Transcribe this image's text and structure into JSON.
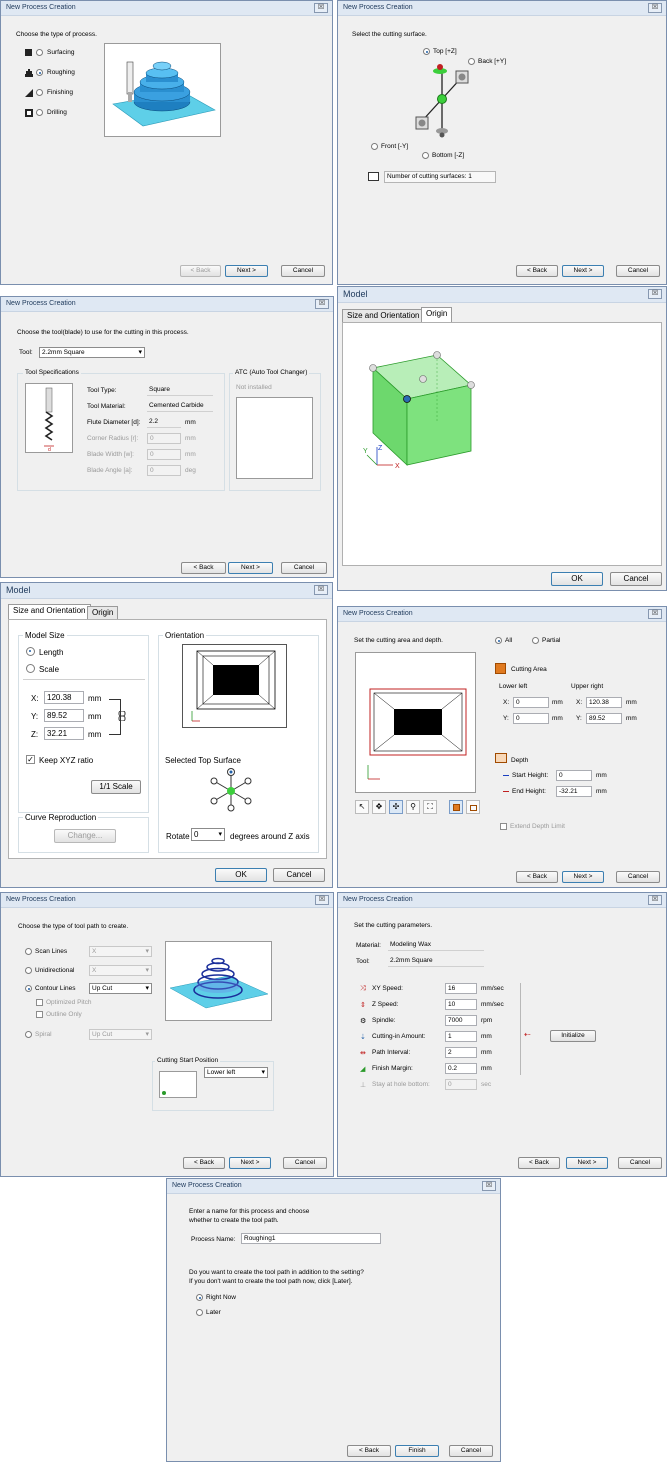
{
  "common": {
    "title": "New Process Creation",
    "close": "☒",
    "back": "< Back",
    "next": "Next >",
    "cancel": "Cancel",
    "finish": "Finish",
    "ok": "OK",
    "model_title": "Model"
  },
  "process_type": {
    "prompt": "Choose the type of process.",
    "options": [
      "Surfacing",
      "Roughing",
      "Finishing",
      "Drilling"
    ],
    "selected": "Roughing"
  },
  "cutting_surface": {
    "prompt": "Select the cutting surface.",
    "top": "Top [+Z]",
    "back": "Back [+Y]",
    "front": "Front [-Y]",
    "bottom": "Bottom [-Z]",
    "count_label": "Number of cutting surfaces: 1"
  },
  "tool": {
    "prompt": "Choose the tool(blade) to use for the cutting in this process.",
    "tool_label": "Tool:",
    "tool_value": "2.2mm Square",
    "specs_heading": "Tool Specifications",
    "atc_heading": "ATC (Auto Tool Changer)",
    "atc_status": "Not installed",
    "rows": [
      {
        "label": "Tool Type:",
        "value": "Square",
        "unit": ""
      },
      {
        "label": "Tool Material:",
        "value": "Cemented Carbide",
        "unit": ""
      },
      {
        "label": "Flute Diameter [d]:",
        "value": "2.2",
        "unit": "mm"
      },
      {
        "label": "Corner Radius [r]:",
        "value": "0",
        "unit": "mm"
      },
      {
        "label": "Blade Width [w]:",
        "value": "0",
        "unit": "mm"
      },
      {
        "label": "Blade Angle [a]:",
        "value": "0",
        "unit": "deg"
      }
    ],
    "diagram_label": "d"
  },
  "model_origin": {
    "tabs": [
      "Size and Orientation",
      "Origin"
    ],
    "active_tab": "Origin",
    "axis_x": "X",
    "axis_y": "Y",
    "axis_z": "Z"
  },
  "model_size": {
    "tabs": [
      "Size and Orientation",
      "Origin"
    ],
    "active_tab": "Size and Orientation",
    "model_size_heading": "Model Size",
    "length_label": "Length",
    "scale_label": "Scale",
    "x_label": "X:",
    "x_value": "120.38",
    "y_label": "Y:",
    "y_value": "89.52",
    "z_label": "Z:",
    "z_value": "32.21",
    "unit": "mm",
    "keep_ratio": "Keep XYZ ratio",
    "scale_btn": "1/1 Scale",
    "curve_heading": "Curve Reproduction",
    "change_btn": "Change...",
    "orientation_heading": "Orientation",
    "selected_top": "Selected Top Surface",
    "rotate_label": "Rotate",
    "rotate_value": "0",
    "rotate_suffix": "degrees around Z axis"
  },
  "cutting_area": {
    "prompt": "Set the cutting area and depth.",
    "all": "All",
    "partial": "Partial",
    "area_heading": "Cutting Area",
    "lower_left": "Lower left",
    "upper_right": "Upper right",
    "ll_x": "0",
    "ll_y": "0",
    "ur_x": "120.38",
    "ur_y": "89.52",
    "x": "X:",
    "y": "Y:",
    "unit": "mm",
    "depth_heading": "Depth",
    "start_label": "Start Height:",
    "start_value": "0",
    "end_label": "End Height:",
    "end_value": "-32.21",
    "extend": "Extend Depth Limit"
  },
  "tool_path": {
    "prompt": "Choose the type of tool path to create.",
    "scan": "Scan Lines",
    "scan_sel": "X",
    "uni": "Unidirectional",
    "uni_sel": "X",
    "contour": "Contour Lines",
    "contour_sel": "Up Cut",
    "opt_pitch": "Optimized Pitch",
    "outline": "Outline Only",
    "spiral": "Spiral",
    "spiral_sel": "Up Cut",
    "start_pos": "Cutting Start Position",
    "start_sel": "Lower left"
  },
  "params": {
    "prompt": "Set the cutting parameters.",
    "material_label": "Material:",
    "material_value": "Modeling Wax",
    "tool_label": "Tool:",
    "tool_value": "2.2mm Square",
    "rows": [
      {
        "label": "XY Speed:",
        "value": "16",
        "unit": "mm/sec"
      },
      {
        "label": "Z Speed:",
        "value": "10",
        "unit": "mm/sec"
      },
      {
        "label": "Spindle:",
        "value": "7000",
        "unit": "rpm"
      },
      {
        "label": "Cutting-in Amount:",
        "value": "1",
        "unit": "mm"
      },
      {
        "label": "Path Interval:",
        "value": "2",
        "unit": "mm"
      },
      {
        "label": "Finish Margin:",
        "value": "0.2",
        "unit": "mm"
      },
      {
        "label": "Stay at hole bottom:",
        "value": "0",
        "unit": "sec"
      }
    ],
    "initialize": "Initialize"
  },
  "name": {
    "prompt1": "Enter a name for this process and choose",
    "prompt2": "whether to create the tool path.",
    "name_label": "Process Name:",
    "name_value": "Roughing1",
    "q1": "Do you want to create the tool path in addition to the setting?",
    "q2": "If you don't want to create the tool path now, click [Later].",
    "now": "Right Now",
    "later": "Later"
  },
  "colors": {
    "accent": "#1f5fa8",
    "model_green": "#7ee27e",
    "platform": "#5ecfe8",
    "dialog_bg": "#f0f0f0"
  }
}
